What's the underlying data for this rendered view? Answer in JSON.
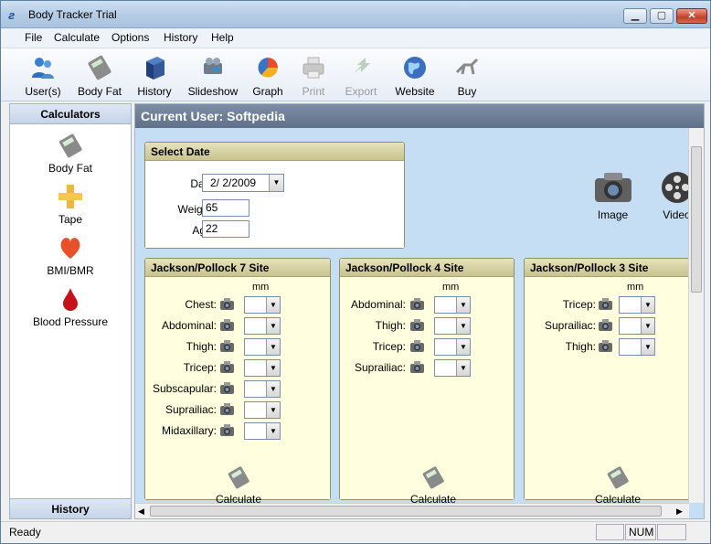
{
  "window": {
    "title": "Body Tracker Trial"
  },
  "menu": [
    "File",
    "Calculate",
    "Options",
    "History",
    "Help"
  ],
  "toolbar": [
    {
      "label": "User(s)",
      "icon": "users-icon",
      "enabled": true
    },
    {
      "label": "Body Fat",
      "icon": "calculator-icon",
      "enabled": true
    },
    {
      "label": "History",
      "icon": "book-icon",
      "enabled": true
    },
    {
      "label": "Slideshow",
      "icon": "projector-icon",
      "enabled": true
    },
    {
      "label": "Graph",
      "icon": "pie-chart-icon",
      "enabled": true
    },
    {
      "label": "Print",
      "icon": "printer-icon",
      "enabled": false
    },
    {
      "label": "Export",
      "icon": "export-icon",
      "enabled": false
    },
    {
      "label": "Website",
      "icon": "globe-icon",
      "enabled": true
    },
    {
      "label": "Buy",
      "icon": "caliper-icon",
      "enabled": true
    }
  ],
  "sidebar": {
    "header": "Calculators",
    "items": [
      {
        "label": "Body Fat",
        "icon": "calculator-icon"
      },
      {
        "label": "Tape",
        "icon": "tape-icon"
      },
      {
        "label": "BMI/BMR",
        "icon": "heart-icon"
      },
      {
        "label": "Blood Pressure",
        "icon": "blood-drop-icon"
      }
    ],
    "footer": "History"
  },
  "main": {
    "header": "Current User: Softpedia",
    "select_date": {
      "title": "Select Date",
      "date_label": "Date:",
      "date_value": "2/ 2/2009",
      "weight_label": "Weight:",
      "weight_value": "65",
      "age_label": "Age:",
      "age_value": "22"
    },
    "media": [
      {
        "label": "Image",
        "icon": "camera-icon"
      },
      {
        "label": "Video",
        "icon": "film-reel-icon"
      }
    ],
    "panels": [
      {
        "title": "Jackson/Pollock 7 Site",
        "unit": "mm",
        "sites": [
          "Chest:",
          "Abdominal:",
          "Thigh:",
          "Tricep:",
          "Subscapular:",
          "Suprailiac:",
          "Midaxillary:"
        ],
        "button": "Calculate"
      },
      {
        "title": "Jackson/Pollock 4 Site",
        "unit": "mm",
        "sites": [
          "Abdominal:",
          "Thigh:",
          "Tricep:",
          "Suprailiac:"
        ],
        "button": "Calculate"
      },
      {
        "title": "Jackson/Pollock 3 Site",
        "unit": "mm",
        "sites": [
          "Tricep:",
          "Suprailiac:",
          "Thigh:"
        ],
        "button": "Calculate"
      }
    ]
  },
  "status": {
    "text": "Ready",
    "num": "NUM"
  }
}
